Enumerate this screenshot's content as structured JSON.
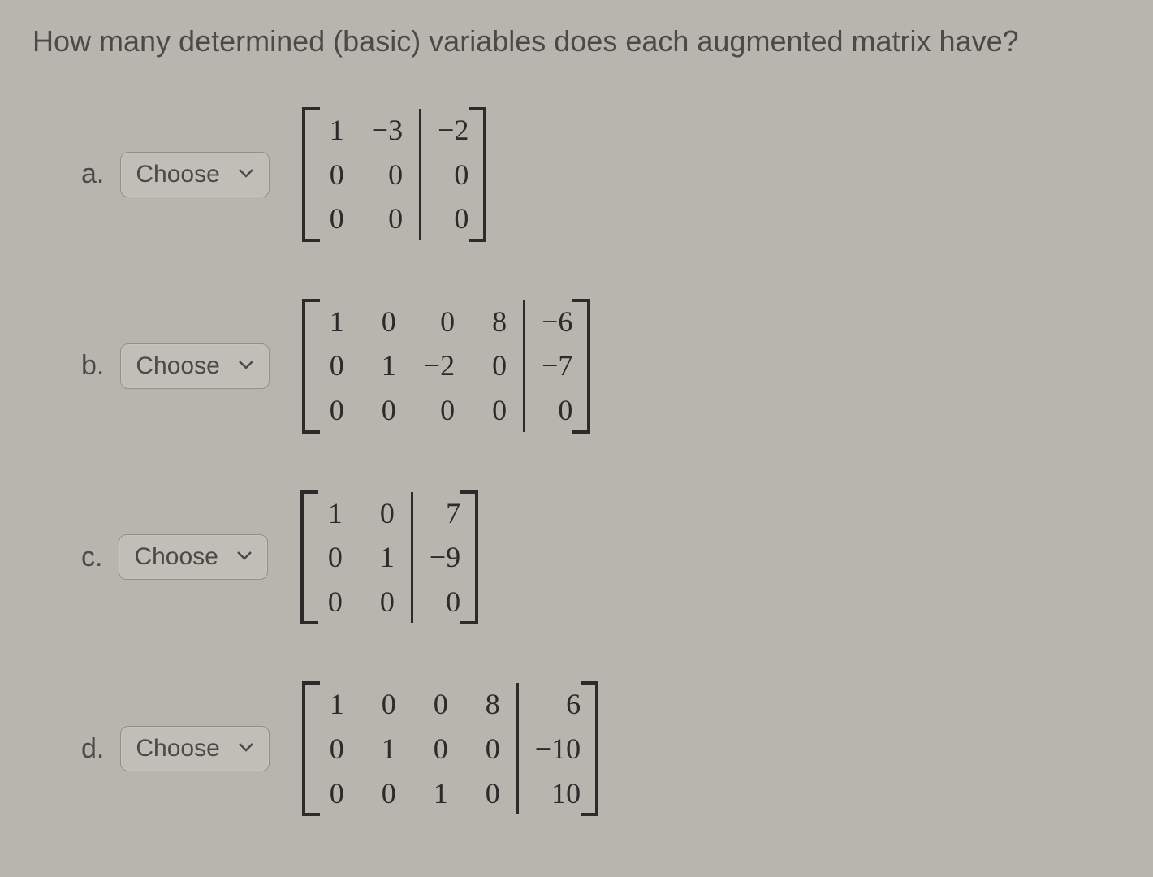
{
  "question": "How many determined (basic) variables does each augmented matrix have?",
  "choose_label": "Choose",
  "parts": {
    "a": {
      "label": "a.",
      "matrix": {
        "left": [
          [
            "1",
            "−3"
          ],
          [
            "0",
            "0"
          ],
          [
            "0",
            "0"
          ]
        ],
        "right": [
          [
            "−2"
          ],
          [
            "0"
          ],
          [
            "0"
          ]
        ]
      }
    },
    "b": {
      "label": "b.",
      "matrix": {
        "left": [
          [
            "1",
            "0",
            "0",
            "8"
          ],
          [
            "0",
            "1",
            "−2",
            "0"
          ],
          [
            "0",
            "0",
            "0",
            "0"
          ]
        ],
        "right": [
          [
            "−6"
          ],
          [
            "−7"
          ],
          [
            "0"
          ]
        ]
      }
    },
    "c": {
      "label": "c.",
      "matrix": {
        "left": [
          [
            "1",
            "0"
          ],
          [
            "0",
            "1"
          ],
          [
            "0",
            "0"
          ]
        ],
        "right": [
          [
            "7"
          ],
          [
            "−9"
          ],
          [
            "0"
          ]
        ]
      }
    },
    "d": {
      "label": "d.",
      "matrix": {
        "left": [
          [
            "1",
            "0",
            "0",
            "8"
          ],
          [
            "0",
            "1",
            "0",
            "0"
          ],
          [
            "0",
            "0",
            "1",
            "0"
          ]
        ],
        "right": [
          [
            "6"
          ],
          [
            "−10"
          ],
          [
            "10"
          ]
        ]
      }
    }
  }
}
